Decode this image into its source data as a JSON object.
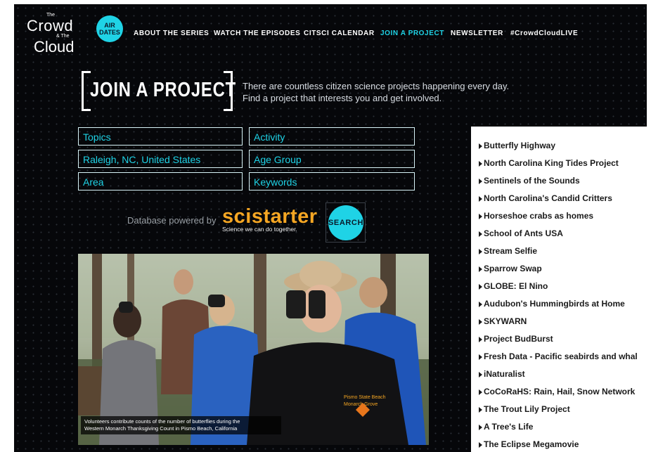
{
  "logo": {
    "word1": "Crowd",
    "the": "The",
    "amp": "& The",
    "word2": "Cloud"
  },
  "nav": {
    "air_dates": "AIR DATES",
    "items": [
      {
        "label": "ABOUT THE SERIES"
      },
      {
        "label": "WATCH THE EPISODES"
      },
      {
        "label": "CITSCI CALENDAR"
      },
      {
        "label": "JOIN A PROJECT",
        "active": true
      },
      {
        "label": "NEWSLETTER"
      },
      {
        "label": "#CrowdCloudLIVE"
      }
    ]
  },
  "heading": {
    "title": "JOIN A PROJECT",
    "intro_line1": "There are countless citizen science projects happening every day.",
    "intro_line2": "Find a project that interests you and get involved."
  },
  "filters": {
    "topics": "Topics",
    "activity": "Activity",
    "location": "Raleigh, NC, United States",
    "age_group": "Age Group",
    "area": "Area",
    "keywords": "Keywords"
  },
  "powered": {
    "text": "Database powered by",
    "brand": "scistarter",
    "tagline": "Science we can do together.",
    "search_label": "SEARCH"
  },
  "photo": {
    "caption_line1": "Volunteers contribute counts of the number of butterflies during the",
    "caption_line2": "Western Monarch Thanksgiving Count in Pismo Beach, California",
    "shirt_text1": "Pismo State Beach",
    "shirt_text2": "Monarch Grove"
  },
  "projects": [
    "Butterfly Highway",
    "North Carolina King Tides Project",
    "Sentinels of the Sounds",
    "North Carolina's Candid Critters",
    "Horseshoe crabs as homes",
    "School of Ants USA",
    "Stream Selfie",
    "Sparrow Swap",
    "GLOBE: El Nino",
    "Audubon's Hummingbirds at Home",
    "SKYWARN",
    "Project BudBurst",
    "Fresh Data - Pacific seabirds and whal",
    "iNaturalist",
    "CoCoRaHS: Rain, Hail, Snow Network",
    "The Trout Lily Project",
    "A Tree's Life",
    "The Eclipse Megamovie"
  ],
  "colors": {
    "accent": "#1fd3e6",
    "scistarter": "#f5a623",
    "background": "#06070a"
  }
}
